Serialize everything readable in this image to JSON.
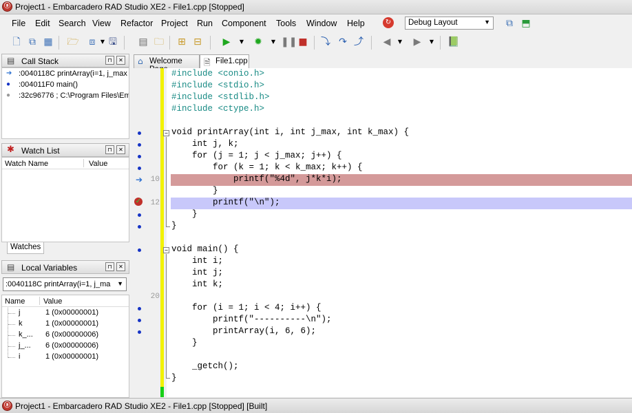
{
  "window": {
    "title": "Project1 - Embarcadero RAD Studio XE2 - File1.cpp [Stopped]"
  },
  "menu": [
    "File",
    "Edit",
    "Search",
    "View",
    "Refactor",
    "Project",
    "Run",
    "Component",
    "Tools",
    "Window",
    "Help"
  ],
  "layout_selector": {
    "value": "Debug Layout"
  },
  "call_stack": {
    "title": "Call Stack",
    "rows": [
      ":0040118C printArray(i=1, j_max",
      ":004011F0 main()",
      ":32c96776 ; C:\\Program Files\\Em"
    ]
  },
  "watch_list": {
    "title": "Watch List",
    "col_name": "Watch Name",
    "col_value": "Value",
    "tab": "Watches"
  },
  "local_variables": {
    "title": "Local Variables",
    "frame": ":0040118C printArray(i=1, j_ma",
    "col_name": "Name",
    "col_value": "Value",
    "rows": [
      {
        "name": "j",
        "value": "1 (0x00000001)"
      },
      {
        "name": "k",
        "value": "1 (0x00000001)"
      },
      {
        "name": "k_...",
        "value": "6 (0x00000006)"
      },
      {
        "name": "j_...",
        "value": "6 (0x00000006)"
      },
      {
        "name": "i",
        "value": "1 (0x00000001)"
      }
    ]
  },
  "tabs": [
    {
      "label": "Welcome Page"
    },
    {
      "label": "File1.cpp"
    }
  ],
  "editor": {
    "line_numbers": {
      "l10": "10",
      "l12": "12",
      "l20": "20"
    },
    "lines": [
      "#include <conio.h>",
      "#include <stdio.h>",
      "#include <stdlib.h>",
      "#include <ctype.h>",
      "",
      "void printArray(int i, int j_max, int k_max) {",
      "    int j, k;",
      "    for (j = 1; j < j_max; j++) {",
      "        for (k = 1; k < k_max; k++) {",
      "            printf(\"%4d\", j*k*i);",
      "        }",
      "        printf(\"\\n\");",
      "    }",
      "}",
      "",
      "void main() {",
      "    int i;",
      "    int j;",
      "    int k;",
      "",
      "    for (i = 1; i < 4; i++) {",
      "        printf(\"----------\\n\");",
      "        printArray(i, 6, 6);",
      "    }",
      "",
      "    _getch();",
      "}"
    ]
  },
  "status": {
    "text": "Project1 - Embarcadero RAD Studio XE2 - File1.cpp [Stopped] [Built]"
  },
  "colors": {
    "exec_line": "#d49a9a",
    "error_line": "#c8c8fa",
    "breakpoint_dot": "#1533c5",
    "change_bar": "#f2f200"
  }
}
